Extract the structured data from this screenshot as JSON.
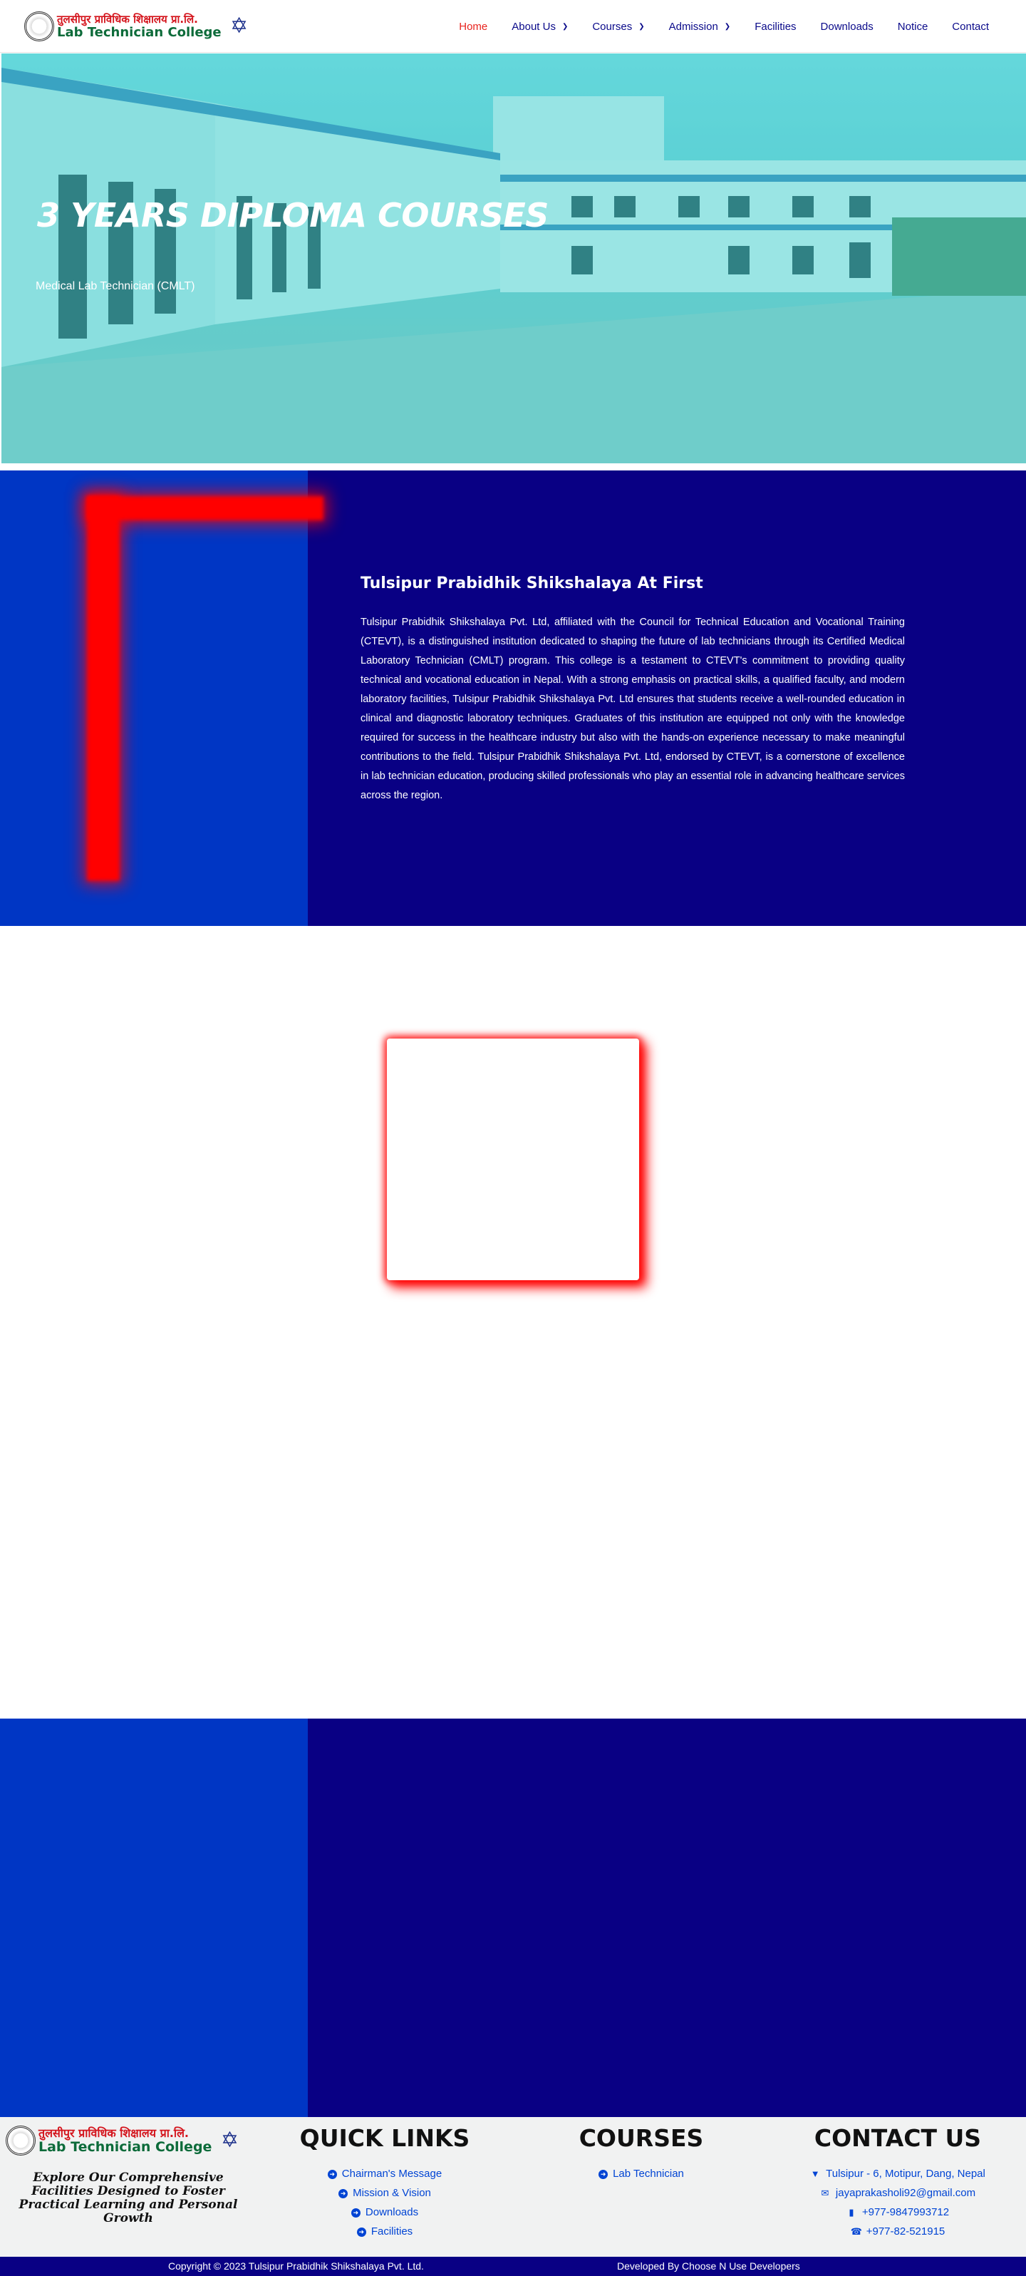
{
  "header": {
    "logo": {
      "nepali": "तुलसीपुर प्राविधिक शिक्षालय प्रा.लि.",
      "english": "Lab Technician College"
    },
    "nav": [
      {
        "label": "Home",
        "active": true,
        "dropdown": false
      },
      {
        "label": "About Us",
        "active": false,
        "dropdown": true
      },
      {
        "label": "Courses",
        "active": false,
        "dropdown": true
      },
      {
        "label": "Admission",
        "active": false,
        "dropdown": true
      },
      {
        "label": "Facilities",
        "active": false,
        "dropdown": false
      },
      {
        "label": "Downloads",
        "active": false,
        "dropdown": false
      },
      {
        "label": "Notice",
        "active": false,
        "dropdown": false
      },
      {
        "label": "Contact",
        "active": false,
        "dropdown": false
      }
    ]
  },
  "hero": {
    "title": "3 YEARS DIPLOMA COURSES",
    "subtitle": "Medical Lab Technician (CMLT)"
  },
  "about": {
    "heading": "Tulsipur Prabidhik Shikshalaya At First",
    "body": "Tulsipur Prabidhik Shikshalaya Pvt. Ltd, affiliated with the Council for Technical Education and Vocational Training (CTEVT), is a distinguished institution dedicated to shaping the future of lab technicians through its Certified Medical Laboratory Technician (CMLT) program. This college is a testament to CTEVT's commitment to providing quality technical and vocational education in Nepal. With a strong emphasis on practical skills, a qualified faculty, and modern laboratory facilities, Tulsipur Prabidhik Shikshalaya Pvt. Ltd ensures that students receive a well-rounded education in clinical and diagnostic laboratory techniques. Graduates of this institution are equipped not only with the knowledge required for success in the healthcare industry but also with the hands-on experience necessary to make meaningful contributions to the field. Tulsipur Prabidhik Shikshalaya Pvt. Ltd, endorsed by CTEVT, is a cornerstone of excellence in lab technician education, producing skilled professionals who play an essential role in advancing healthcare services across the region."
  },
  "footer": {
    "logo": {
      "nepali": "तुलसीपुर प्राविधिक शिक्षालय प्रा.लि.",
      "english": "Lab Technician College"
    },
    "tagline": "Explore Our Comprehensive Facilities Designed to Foster Practical Learning and Personal Growth",
    "quick_links": {
      "title": "QUICK LINKS",
      "items": [
        "Chairman's Message",
        "Mission & Vision",
        "Downloads",
        "Facilities"
      ]
    },
    "courses": {
      "title": "COURSES",
      "items": [
        "Lab Technician"
      ]
    },
    "contact": {
      "title": "CONTACT US",
      "address": "Tulsipur - 6, Motipur, Dang, Nepal",
      "email": "jayaprakasholi92@gmail.com",
      "mobile": "+977-9847993712",
      "phone": "+977-82-521915"
    }
  },
  "copyright": {
    "left": "Copyright © 2023 Tulsipur Prabidhik Shikshalaya Pvt. Ltd.",
    "right": "Developed By Choose N Use Developers"
  },
  "colors": {
    "nav_text": "#0a0a8a",
    "nav_active": "#e8231e",
    "blue_left": "#0036c4",
    "navy": "#090084",
    "red_accent": "#ff0000",
    "link_blue": "#0044d4"
  }
}
